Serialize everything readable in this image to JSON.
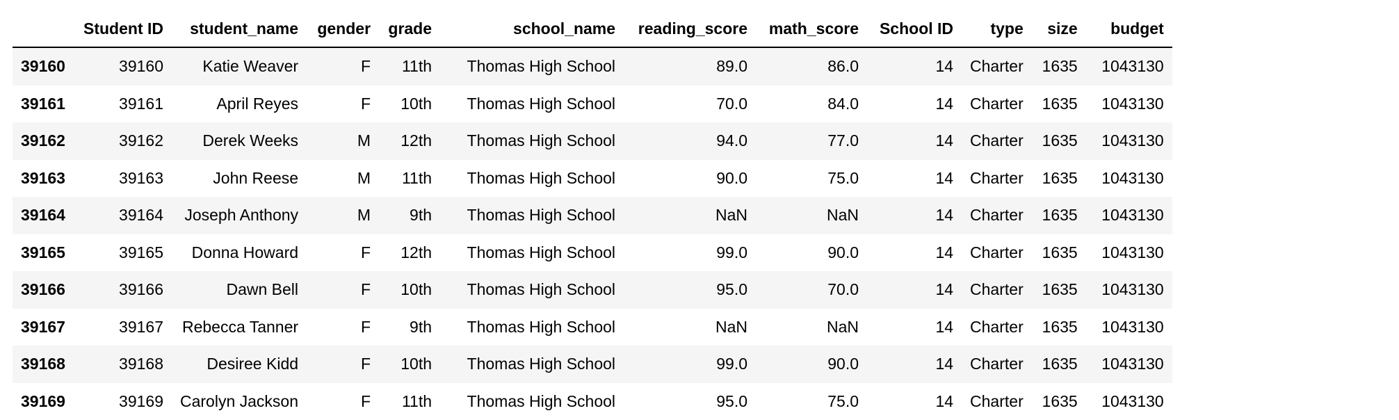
{
  "table": {
    "columns": [
      "",
      "Student ID",
      "student_name",
      "gender",
      "grade",
      "school_name",
      "reading_score",
      "math_score",
      "School ID",
      "type",
      "size",
      "budget"
    ],
    "rows": [
      {
        "index": "39160",
        "student_id": "39160",
        "student_name": "Katie Weaver",
        "gender": "F",
        "grade": "11th",
        "school_name": "Thomas High School",
        "reading_score": "89.0",
        "math_score": "86.0",
        "school_id": "14",
        "type": "Charter",
        "size": "1635",
        "budget": "1043130"
      },
      {
        "index": "39161",
        "student_id": "39161",
        "student_name": "April Reyes",
        "gender": "F",
        "grade": "10th",
        "school_name": "Thomas High School",
        "reading_score": "70.0",
        "math_score": "84.0",
        "school_id": "14",
        "type": "Charter",
        "size": "1635",
        "budget": "1043130"
      },
      {
        "index": "39162",
        "student_id": "39162",
        "student_name": "Derek Weeks",
        "gender": "M",
        "grade": "12th",
        "school_name": "Thomas High School",
        "reading_score": "94.0",
        "math_score": "77.0",
        "school_id": "14",
        "type": "Charter",
        "size": "1635",
        "budget": "1043130"
      },
      {
        "index": "39163",
        "student_id": "39163",
        "student_name": "John Reese",
        "gender": "M",
        "grade": "11th",
        "school_name": "Thomas High School",
        "reading_score": "90.0",
        "math_score": "75.0",
        "school_id": "14",
        "type": "Charter",
        "size": "1635",
        "budget": "1043130"
      },
      {
        "index": "39164",
        "student_id": "39164",
        "student_name": "Joseph Anthony",
        "gender": "M",
        "grade": "9th",
        "school_name": "Thomas High School",
        "reading_score": "NaN",
        "math_score": "NaN",
        "school_id": "14",
        "type": "Charter",
        "size": "1635",
        "budget": "1043130"
      },
      {
        "index": "39165",
        "student_id": "39165",
        "student_name": "Donna Howard",
        "gender": "F",
        "grade": "12th",
        "school_name": "Thomas High School",
        "reading_score": "99.0",
        "math_score": "90.0",
        "school_id": "14",
        "type": "Charter",
        "size": "1635",
        "budget": "1043130"
      },
      {
        "index": "39166",
        "student_id": "39166",
        "student_name": "Dawn Bell",
        "gender": "F",
        "grade": "10th",
        "school_name": "Thomas High School",
        "reading_score": "95.0",
        "math_score": "70.0",
        "school_id": "14",
        "type": "Charter",
        "size": "1635",
        "budget": "1043130"
      },
      {
        "index": "39167",
        "student_id": "39167",
        "student_name": "Rebecca Tanner",
        "gender": "F",
        "grade": "9th",
        "school_name": "Thomas High School",
        "reading_score": "NaN",
        "math_score": "NaN",
        "school_id": "14",
        "type": "Charter",
        "size": "1635",
        "budget": "1043130"
      },
      {
        "index": "39168",
        "student_id": "39168",
        "student_name": "Desiree Kidd",
        "gender": "F",
        "grade": "10th",
        "school_name": "Thomas High School",
        "reading_score": "99.0",
        "math_score": "90.0",
        "school_id": "14",
        "type": "Charter",
        "size": "1635",
        "budget": "1043130"
      },
      {
        "index": "39169",
        "student_id": "39169",
        "student_name": "Carolyn Jackson",
        "gender": "F",
        "grade": "11th",
        "school_name": "Thomas High School",
        "reading_score": "95.0",
        "math_score": "75.0",
        "school_id": "14",
        "type": "Charter",
        "size": "1635",
        "budget": "1043130"
      }
    ]
  },
  "colors": {
    "row_stripe": "#f5f5f5",
    "row_plain": "#ffffff",
    "header_rule": "#000000"
  }
}
